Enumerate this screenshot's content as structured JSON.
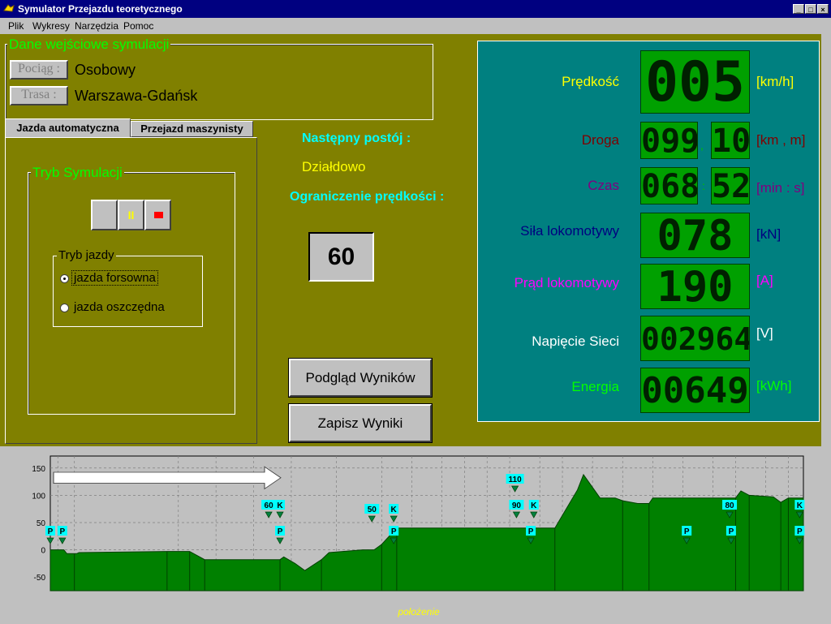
{
  "window": {
    "title": "Symulator Przejazdu teoretycznego"
  },
  "menu": [
    "Plik",
    "Wykresy",
    "Narzędzia",
    "Pomoc"
  ],
  "input_group": {
    "title": "Dane wejściowe symulacji",
    "train_button": "Pociąg :",
    "train_value": "Osobowy",
    "route_button": "Trasa :",
    "route_value": "Warszawa-Gdańsk"
  },
  "tabs": [
    "Jazda automatyczna",
    "Przejazd maszynisty"
  ],
  "sim_mode": {
    "title": "Tryb Symulacji",
    "drive_mode_title": "Tryb jazdy",
    "options": [
      "jazda forsowna",
      "jazda oszczędna"
    ],
    "selected": 0,
    "pause_glyph": "II"
  },
  "info": {
    "next_stop_label": "Następny postój :",
    "next_stop_value": "Działdowo",
    "speed_limit_label": "Ograniczenie prędkości :",
    "speed_limit_value": "60"
  },
  "buttons": {
    "preview": "Podgląd Wyników",
    "save": "Zapisz Wyniki"
  },
  "readouts": {
    "speed": {
      "label": "Prędkość",
      "value": "005",
      "unit": "[km/h]"
    },
    "distance": {
      "label": "Droga",
      "km": "099",
      "sep": ",",
      "m": "10",
      "unit": "[km , m]"
    },
    "time": {
      "label": "Czas",
      "min": "068",
      "sep": ":",
      "s": "52",
      "unit": "[min : s]"
    },
    "force": {
      "label": "Siła lokomotywy",
      "value": "078",
      "unit": "[kN]"
    },
    "current": {
      "label": "Prąd lokomotywy",
      "value": "190",
      "unit": "[A]"
    },
    "voltage": {
      "label": "Napięcie Sieci",
      "value": "002964",
      "unit": "[V]"
    },
    "energy": {
      "label": "Energia",
      "value": "00649",
      "unit": "[kWh]"
    }
  },
  "colors": {
    "main_bg": "#808000",
    "panel_bg": "#008080",
    "lcd_bg": "#00a000",
    "profile_fill": "#008000",
    "marker_label_bg": "#00ffff"
  },
  "chart_data": {
    "type": "area",
    "xlabel": "położenie",
    "yticks": [
      150,
      100,
      50,
      0,
      -50
    ],
    "ylim": [
      -75,
      172
    ],
    "xlim": [
      0,
      100
    ],
    "profile": [
      [
        0,
        0
      ],
      [
        1.8,
        0
      ],
      [
        2.2,
        -7
      ],
      [
        3.5,
        -7
      ],
      [
        3.8,
        -5
      ],
      [
        15.5,
        -3
      ],
      [
        18.5,
        -3
      ],
      [
        20.5,
        -18
      ],
      [
        30.5,
        -18
      ],
      [
        31,
        -13
      ],
      [
        32.5,
        -25
      ],
      [
        33.8,
        -38
      ],
      [
        36,
        -18
      ],
      [
        37,
        -5
      ],
      [
        41.5,
        0
      ],
      [
        43,
        0
      ],
      [
        44,
        10
      ],
      [
        46,
        40
      ],
      [
        65,
        40
      ],
      [
        67,
        40
      ],
      [
        70,
        110
      ],
      [
        70.8,
        138
      ],
      [
        73,
        95
      ],
      [
        75,
        95
      ],
      [
        76,
        90
      ],
      [
        78,
        85
      ],
      [
        79.5,
        85
      ],
      [
        80,
        95
      ],
      [
        91,
        95
      ],
      [
        91.7,
        108
      ],
      [
        92.8,
        100
      ],
      [
        96,
        97
      ],
      [
        97,
        87
      ],
      [
        98,
        95
      ],
      [
        100,
        95
      ]
    ],
    "markers": [
      {
        "label": "P",
        "x": 0,
        "row": 2
      },
      {
        "label": "P",
        "x": 1.6,
        "row": 2
      },
      {
        "label": "60",
        "x": 29,
        "row": 0
      },
      {
        "label": "K",
        "x": 30.5,
        "row": 0
      },
      {
        "label": "P",
        "x": 30.5,
        "row": 2
      },
      {
        "label": "50",
        "x": 42.7,
        "row": 1
      },
      {
        "label": "K",
        "x": 45.6,
        "row": 1
      },
      {
        "label": "P",
        "x": 45.6,
        "row": 2
      },
      {
        "label": "110",
        "x": 61.7,
        "row": -1
      },
      {
        "label": "90",
        "x": 61.9,
        "row": 0
      },
      {
        "label": "K",
        "x": 64.2,
        "row": 0
      },
      {
        "label": "P",
        "x": 63.8,
        "row": 2
      },
      {
        "label": "P",
        "x": 84.5,
        "row": 2
      },
      {
        "label": "80",
        "x": 90.2,
        "row": 0
      },
      {
        "label": "P",
        "x": 90.4,
        "row": 2
      },
      {
        "label": "K",
        "x": 99.5,
        "row": 0
      },
      {
        "label": "P",
        "x": 99.5,
        "row": 2
      }
    ]
  }
}
